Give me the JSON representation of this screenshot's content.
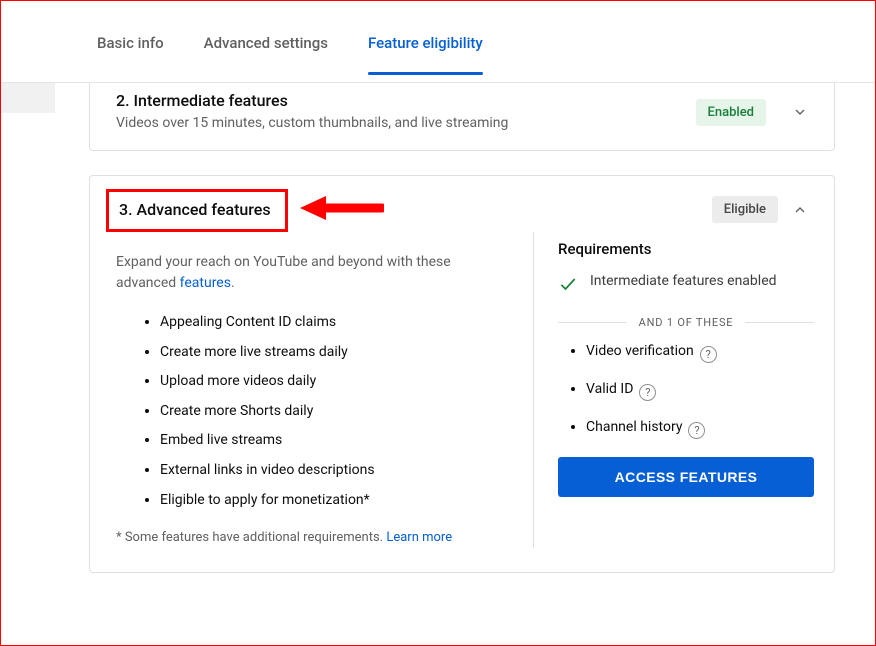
{
  "tabs": {
    "basic": "Basic info",
    "advanced": "Advanced settings",
    "eligibility": "Feature eligibility"
  },
  "card2": {
    "title": "2. Intermediate features",
    "sub": "Videos over 15 minutes, custom thumbnails, and live streaming",
    "badge": "Enabled"
  },
  "card3": {
    "title": "3. Advanced features",
    "badge": "Eligible",
    "desc_pre": "Expand your reach on YouTube and beyond with these advanced ",
    "desc_link": "features",
    "desc_post": ".",
    "features": [
      "Appealing Content ID claims",
      "Create more live streams daily",
      "Upload more videos daily",
      "Create more Shorts daily",
      "Embed live streams",
      "External links in video descriptions",
      "Eligible to apply for monetization*"
    ],
    "footnote_pre": "* Some features have additional requirements. ",
    "footnote_link": "Learn more",
    "req": {
      "title": "Requirements",
      "met": "Intermediate features enabled",
      "divider": "AND 1 OF THESE",
      "options": [
        "Video verification",
        "Valid ID",
        "Channel history"
      ],
      "cta": "ACCESS FEATURES"
    }
  }
}
